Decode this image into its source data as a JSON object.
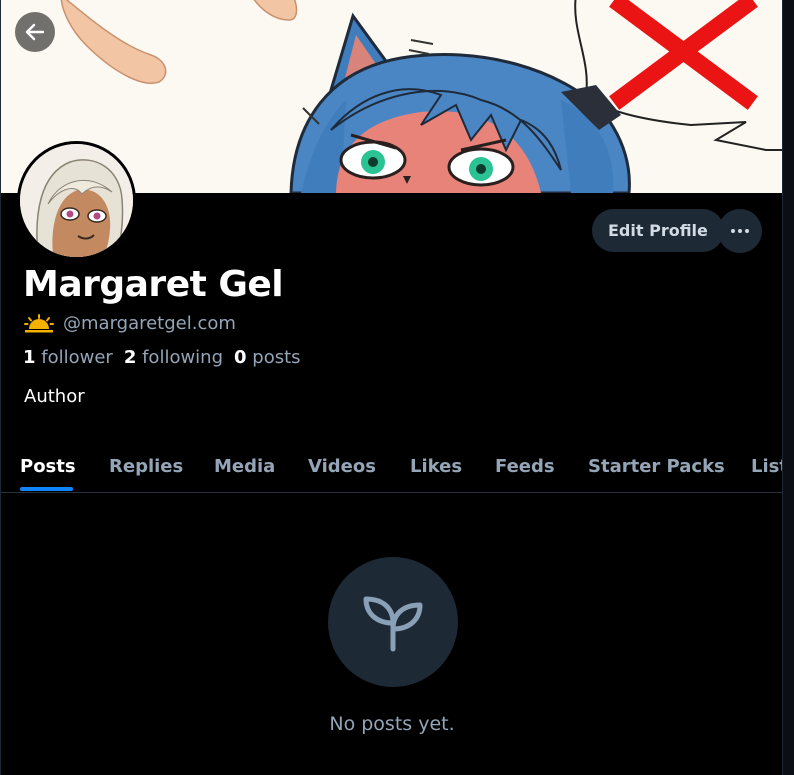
{
  "profile": {
    "display_name": "Margaret Gel",
    "handle": "@margaretgel.com",
    "bio": "Author"
  },
  "stats": [
    {
      "count": "1",
      "label": "follower"
    },
    {
      "count": "2",
      "label": "following"
    },
    {
      "count": "0",
      "label": "posts"
    }
  ],
  "actions": {
    "edit_profile": "Edit Profile"
  },
  "tabs": [
    {
      "label": "Posts"
    },
    {
      "label": "Replies"
    },
    {
      "label": "Media"
    },
    {
      "label": "Videos"
    },
    {
      "label": "Likes"
    },
    {
      "label": "Feeds"
    },
    {
      "label": "Starter Packs"
    },
    {
      "label": "Lists"
    }
  ],
  "active_tab": "Posts",
  "empty_state": {
    "text": "No posts yet.",
    "icon": "sprout-icon"
  },
  "icons": {
    "back": "arrow-left-icon",
    "more": "ellipsis-icon",
    "handle_badge": "sunrise-icon"
  },
  "colors": {
    "background": "#000000",
    "surface": "#1e2936",
    "muted_text": "#93a5b7",
    "accent": "#1083fe",
    "badge": "#f5b100"
  }
}
